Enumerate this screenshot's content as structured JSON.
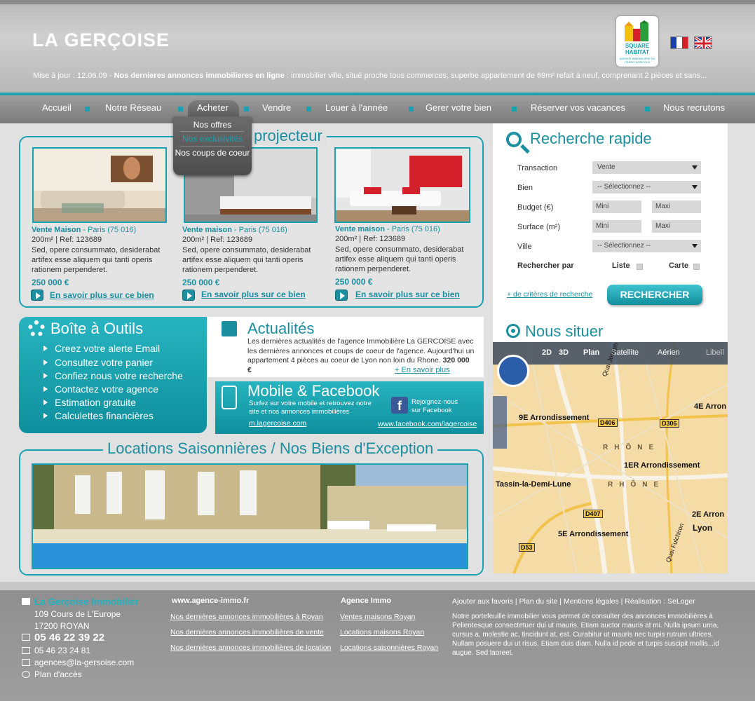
{
  "header": {
    "logo": "LA GERÇOISE",
    "partner_logo_line1": "SQUARE",
    "partner_logo_line2": "HABITAT",
    "partner_logo_sub": "AGENCE IMMOBILIÈRE DU CRÉDIT AGRICOLE",
    "update_label": "Mise à jour : 12.06.09",
    "ticker_sep": " - ",
    "ticker_bold": "Nos dernieres annonces immobilieres en ligne",
    "ticker_text": " : immobilier ville, situé proche tous commerces, superbe appartement de 69m² refait à neuf, comprenant 2 pièces et sans...",
    "lang_fr": "fr",
    "lang_en": "en"
  },
  "nav": {
    "items": [
      "Accueil",
      "Notre Réseau",
      "Acheter",
      "Vendre",
      "Louer à l'année",
      "Gerer votre bien",
      "Réserver vos vacances",
      "Nous recrutons"
    ],
    "dropdown": [
      "Nos offres",
      "Nos exclusivités",
      "Nos coups de coeur"
    ]
  },
  "projecteur": {
    "title": "projecteur",
    "properties": [
      {
        "title": "Vente Maison",
        "location": " - Paris (75 016)",
        "ref": "200m² | Ref: 123689",
        "desc": "Sed, opere consummato, desiderabat artifex esse aliquem qui tanti operis rationem perpenderet.",
        "price": "250 000 €",
        "link": "En savoir plus sur ce bien"
      },
      {
        "title": "Vente maison",
        "location": " - Paris (75 016)",
        "ref": "200m² | Ref: 123689",
        "desc": "Sed, opere consummato, desiderabat artifex esse aliquem qui tanti operis rationem perpenderet.",
        "price": "250 000 €",
        "link": "En savoir plus sur ce bien"
      },
      {
        "title": "Vente maison",
        "location": " - Paris (75 016)",
        "ref": "200m² | Ref: 123689",
        "desc": "Sed, opere consummato, desiderabat artifex esse aliquem qui tanti operis rationem perpenderet.",
        "price": "250 000 €",
        "link": "En savoir plus sur ce bien"
      }
    ]
  },
  "tools": {
    "title": "Boîte à Outils",
    "items": [
      "Creez votre alerte Email",
      "Consultez votre panier",
      "Confiez nous votre recherche",
      "Contactez votre agence",
      "Estimation gratuite",
      "Calculettes financières"
    ]
  },
  "actualites": {
    "title": "Actualités",
    "text": "Les dernières actualités de l'agence Immobilière La GERCOISE avec les dernières annonces et coups de coeur de l'agence. Aujourd'hui un appartement 4 pièces au coeur de Lyon non loin du Rhone.",
    "price": " 320 000 €",
    "link": "+ En savoir plus"
  },
  "mobile": {
    "title": "Mobile & Facebook",
    "text": "Surfez sur votre mobile et retrouvez notre site et nos annonces immobilières",
    "link": "m.lagercoise.com",
    "fb_text": "Rejoignez-nous sur Facebook",
    "fb_link": "www.facebook.com/lagercoise"
  },
  "locations": {
    "title": "Locations Saisonnières / Nos Biens d'Exception"
  },
  "search": {
    "title": "Recherche rapide",
    "labels": [
      "Transaction",
      "Bien",
      "Budget (€)",
      "Surface (m²)",
      "Ville"
    ],
    "transaction_value": "Vente",
    "bien_value": "-- Sélectionnez --",
    "ville_value": "-- Sélectionnez --",
    "min_placeholder": "Mini",
    "max_placeholder": "Maxi",
    "rechercher_par": "Rechercher par",
    "liste": "Liste",
    "carte": "Carte",
    "criteres": "+ de critères de recherche",
    "button": "RECHERCHER"
  },
  "situer": {
    "title": "Nous situer",
    "map_tabs": [
      "2D",
      "3D",
      "Plan",
      "Satellite",
      "Aérien",
      "Libell"
    ],
    "labels": [
      "9E Arrondissement",
      "4E Arron",
      "1ER Arrondissement",
      "Tassin-la-Demi-Lune",
      "2E Arron",
      "5E Arrondissement",
      "Lyon",
      "Quai Joseph",
      "Quai Fulchiron"
    ],
    "roads": [
      "D406",
      "D306",
      "D407",
      "D53"
    ],
    "river": "RHÔNE"
  },
  "footer": {
    "brand": "La Gerçoise Immobilier",
    "address1": "109 Cours de L'Europe",
    "address2": "17200 ROYAN",
    "phone": "05 46 22 39 22",
    "fax": "05 46 23 24 81",
    "email": "agences@la-gersoise.com",
    "plan": "Plan d'accès",
    "col2_head": "www.agence-immo.fr",
    "col2_links": [
      "Nos dernières annonces immobilières à Royan",
      "Nos dernières annonces immobilières de vente",
      "Nos dernières annonces immobilières de location"
    ],
    "col3_head": "Agence Immo",
    "col3_links": [
      "Ventes maisons Royan ",
      "Locations maisons Royan",
      "Locations saisonnières Royan"
    ],
    "toplinks": "Ajouter aux favoris   |   Plan du site   |   Mentions légales   |   Réalisation : SeLoger",
    "desc": "Notre portefeuille immobilier vous permet de consulter des annonces immobilières à Pellentesque consectetuer dui ut mauris. Etiam auctor mauris at mi. Nulla ipsum urna, cursus a, molestie ac, tincidunt at, est. Curabitur ut mauris nec turpis rutrum ultrices. Nullam posuere dui ut risus. Etiam duis diam. Nulla id pede et turpis suscipit mollis...id augue. Sed laoreet."
  }
}
